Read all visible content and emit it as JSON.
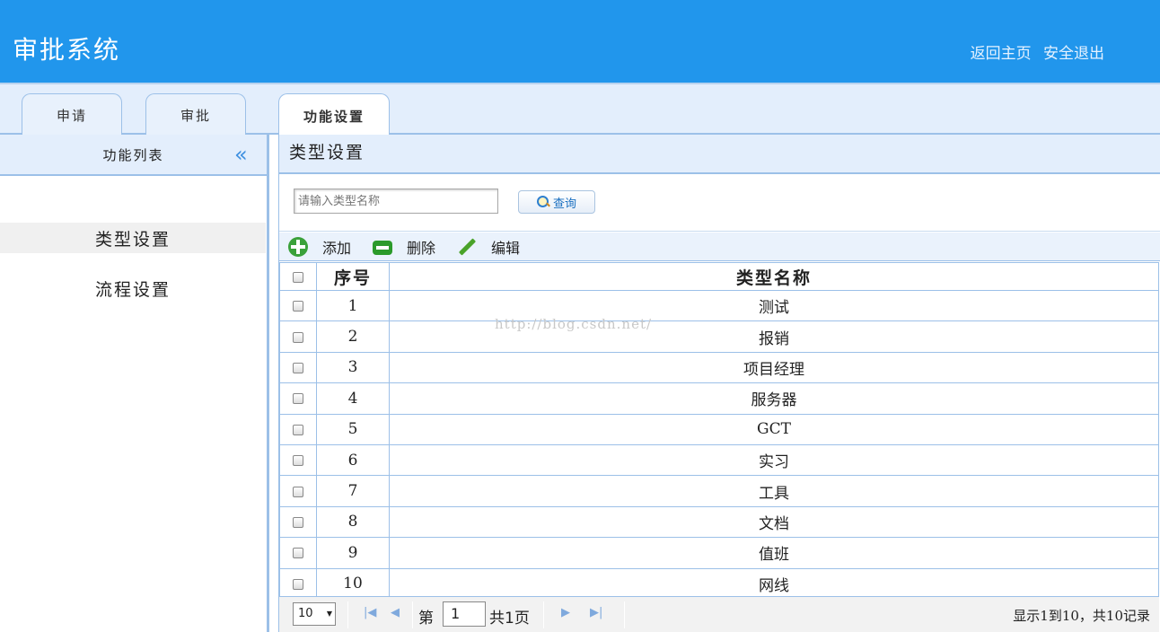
{
  "header": {
    "title": "审批系统",
    "links": [
      "返回主页",
      "安全退出"
    ]
  },
  "tabs": [
    {
      "label": "申请"
    },
    {
      "label": "审批"
    },
    {
      "label": "功能设置"
    }
  ],
  "sidebar": {
    "title": "功能列表",
    "items": [
      {
        "label": "类型设置"
      },
      {
        "label": "流程设置"
      }
    ]
  },
  "main": {
    "title": "类型设置",
    "search": {
      "placeholder": "请输入类型名称",
      "button_label": "查询"
    },
    "toolbar": {
      "add_label": "添加",
      "delete_label": "删除",
      "edit_label": "编辑"
    },
    "table": {
      "columns": [
        "序号",
        "类型名称"
      ],
      "rows": [
        {
          "no": "1",
          "name": "测试"
        },
        {
          "no": "2",
          "name": "报销"
        },
        {
          "no": "3",
          "name": "项目经理"
        },
        {
          "no": "4",
          "name": "服务器"
        },
        {
          "no": "5",
          "name": "GCT"
        },
        {
          "no": "6",
          "name": "实习"
        },
        {
          "no": "7",
          "name": "工具"
        },
        {
          "no": "8",
          "name": "文档"
        },
        {
          "no": "9",
          "name": "值班"
        },
        {
          "no": "10",
          "name": "网线"
        }
      ]
    },
    "watermark": "http://blog.csdn.net/",
    "pager": {
      "page_size": "10",
      "page_prefix": "第",
      "current_page": "1",
      "page_suffix": "共1页",
      "summary": "显示1到10，共10记录"
    }
  }
}
